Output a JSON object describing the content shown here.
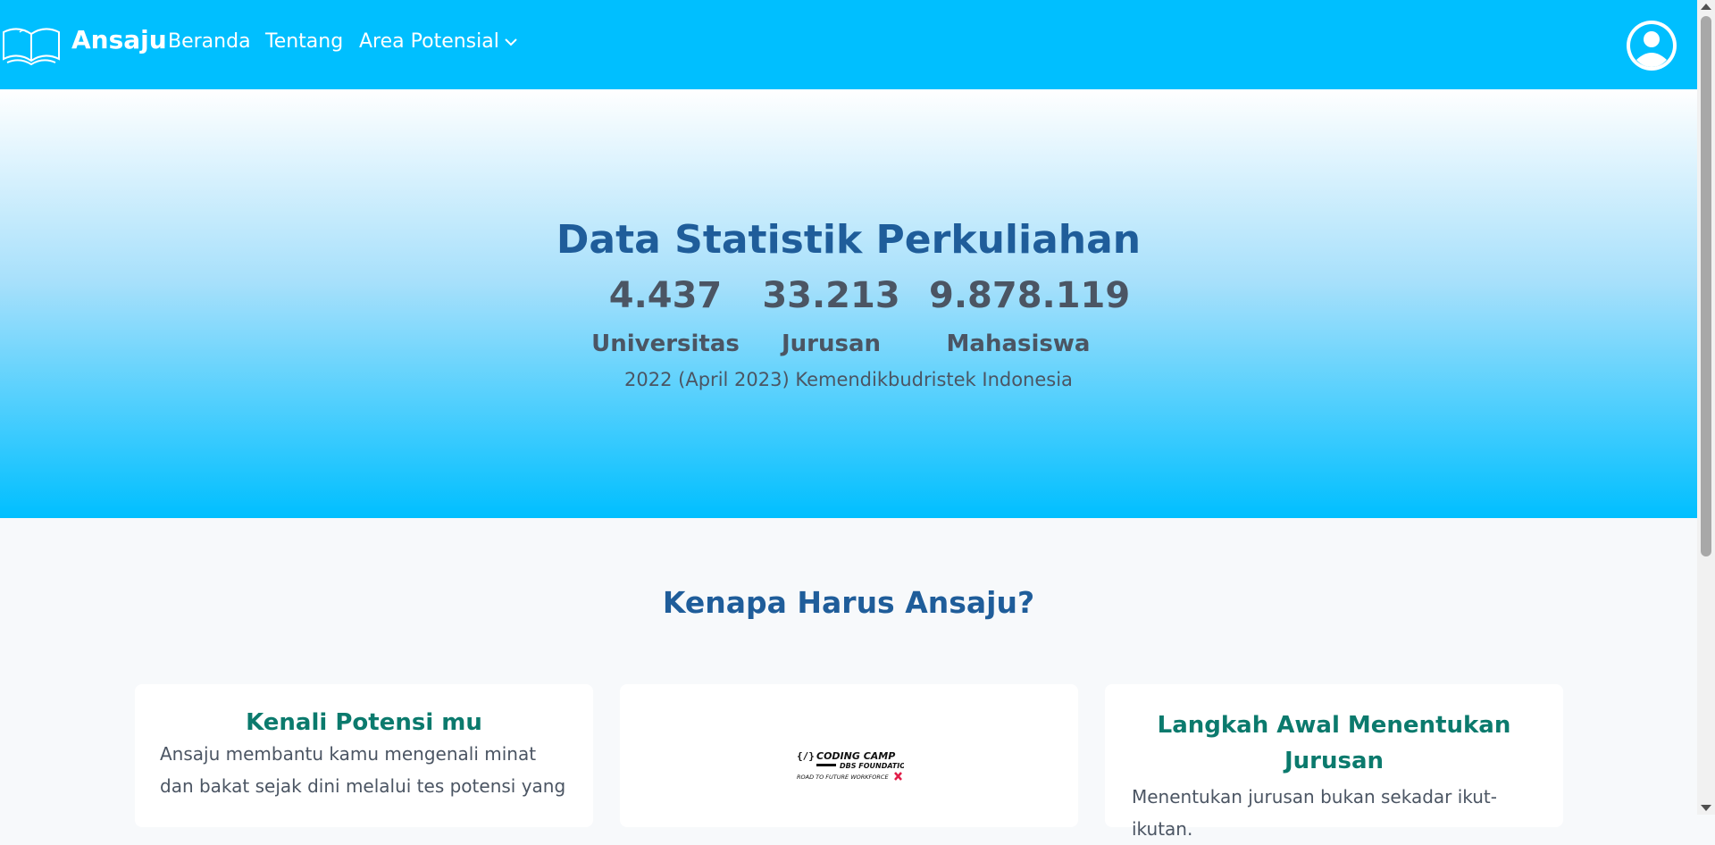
{
  "nav": {
    "brand": "Ansaju",
    "links": [
      "Beranda",
      "Tentang",
      "Area Potensial"
    ],
    "icons": {
      "logo": "book-icon",
      "dropdown": "chevron-down-icon",
      "profile": "user-avatar-icon"
    }
  },
  "hero": {
    "title": "Data Statistik Perkuliahan",
    "stats": [
      {
        "value": "4.437",
        "label": "Universitas"
      },
      {
        "value": "33.213",
        "label": "Jurusan"
      },
      {
        "value": "9.878.119",
        "label": "Mahasiswa"
      }
    ],
    "source": "2022 (April 2023) Kemendikbudristek Indonesia"
  },
  "why": {
    "title": "Kenapa Harus Ansaju?",
    "cards": [
      {
        "title": "Kenali Potensi mu",
        "text": "Ansaju membantu kamu mengenali minat dan bakat sejak dini melalui tes potensi yang"
      },
      {
        "logo_line1": "CODING CAMP",
        "logo_line2": "DBS FOUNDATION",
        "logo_line3": "ROAD TO FUTURE WORKFORCE"
      },
      {
        "title": "Langkah Awal Menentukan Jurusan",
        "text": "Menentukan jurusan bukan sekadar ikut-ikutan."
      }
    ]
  },
  "colors": {
    "navbar": "#00bfff",
    "heading": "#1f5d9a",
    "card_title": "#0b7a6d",
    "text": "#4b5563"
  }
}
